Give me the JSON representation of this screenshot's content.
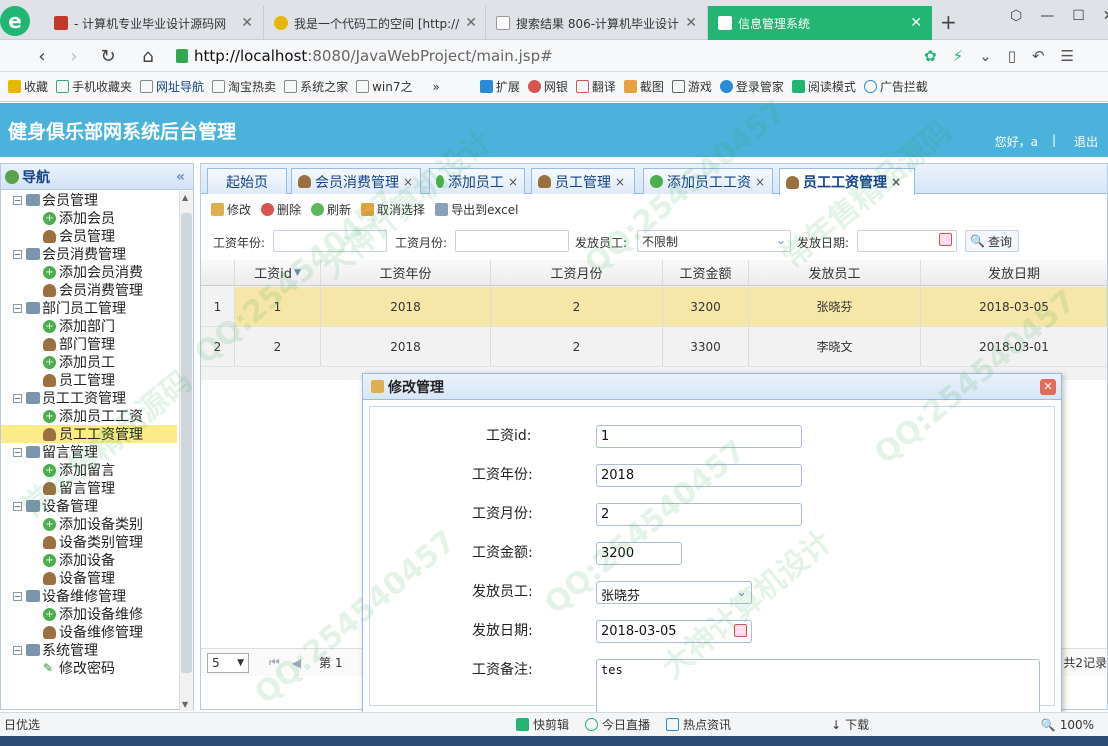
{
  "browser": {
    "tabs": [
      {
        "title": "- 计算机专业毕业设计源码网",
        "favicon_color": "#c0392b"
      },
      {
        "title": "我是一个代码工的空间 [http://",
        "favicon_color": "#e6b800"
      },
      {
        "title": "搜索结果 806-计算机毕业设计",
        "favicon_color": "#ffffff"
      },
      {
        "title": "信息管理系统",
        "favicon_color": "#ffffff"
      }
    ],
    "new_tab": "+",
    "url_host": "http://localhost",
    "url_path": ":8080/JavaWebProject/main.jsp#",
    "bookmarks": [
      "收藏",
      "手机收藏夹",
      "网址导航",
      "淘宝热卖",
      "系统之家",
      "win7之"
    ],
    "extensions": [
      "扩展",
      "网银",
      "翻译",
      "截图",
      "游戏",
      "登录管家",
      "阅读模式",
      "广告拦截"
    ]
  },
  "header": {
    "title": "健身俱乐部网系统后台管理",
    "greeting": "您好，a",
    "logout": "退出"
  },
  "sidebar": {
    "title": "导航",
    "groups": [
      {
        "label": "会员管理",
        "items": [
          "添加会员",
          "会员管理"
        ]
      },
      {
        "label": "会员消费管理",
        "items": [
          "添加会员消费",
          "会员消费管理"
        ]
      },
      {
        "label": "部门员工管理",
        "items": [
          "添加部门",
          "部门管理",
          "添加员工",
          "员工管理"
        ]
      },
      {
        "label": "员工工资管理",
        "items": [
          "添加员工工资",
          "员工工资管理"
        ]
      },
      {
        "label": "留言管理",
        "items": [
          "添加留言",
          "留言管理"
        ]
      },
      {
        "label": "设备管理",
        "items": [
          "添加设备类别",
          "设备类别管理",
          "添加设备",
          "设备管理"
        ]
      },
      {
        "label": "设备维修管理",
        "items": [
          "添加设备维修",
          "设备维修管理"
        ]
      },
      {
        "label": "系统管理",
        "items": [
          "修改密码"
        ]
      }
    ],
    "selected": "员工工资管理"
  },
  "main_tabs": [
    "起始页",
    "会员消费管理",
    "添加员工",
    "员工管理",
    "添加员工工资",
    "员工工资管理"
  ],
  "toolbar": {
    "edit": "修改",
    "delete": "删除",
    "refresh": "刷新",
    "cancel_select": "取消选择",
    "export": "导出到excel"
  },
  "filters": {
    "year_label": "工资年份:",
    "month_label": "工资月份:",
    "employee_label": "发放员工:",
    "employee_value": "不限制",
    "date_label": "发放日期:",
    "query": "查询"
  },
  "grid": {
    "columns": [
      "工资id",
      "工资年份",
      "工资月份",
      "工资金额",
      "发放员工",
      "发放日期"
    ],
    "rows": [
      {
        "no": "1",
        "id": "1",
        "year": "2018",
        "month": "2",
        "amount": "3200",
        "employee": "张晓芬",
        "date": "2018-03-05"
      },
      {
        "no": "2",
        "id": "2",
        "year": "2018",
        "month": "2",
        "amount": "3300",
        "employee": "李晓文",
        "date": "2018-03-01"
      }
    ]
  },
  "pager": {
    "page_size": "5",
    "page_prefix": "第 1",
    "total": "共2记录"
  },
  "dialog": {
    "title": "修改管理",
    "fields": [
      {
        "label": "工资id:",
        "value": "1"
      },
      {
        "label": "工资年份:",
        "value": "2018"
      },
      {
        "label": "工资月份:",
        "value": "2"
      },
      {
        "label": "工资金额:",
        "value": "3200"
      },
      {
        "label": "发放员工:",
        "value": "张晓芬"
      },
      {
        "label": "发放日期:",
        "value": "2018-03-05"
      },
      {
        "label": "工资备注:",
        "value": "tes"
      }
    ]
  },
  "statusbar": {
    "left": "日优选",
    "items": [
      "快剪辑",
      "今日直播",
      "热点资讯",
      "下载"
    ],
    "zoom": "100%"
  },
  "watermark": {
    "texts": [
      "QQ:254540457",
      "常年售精品源码",
      "大神计算机设计"
    ],
    "color": "#28a046"
  }
}
